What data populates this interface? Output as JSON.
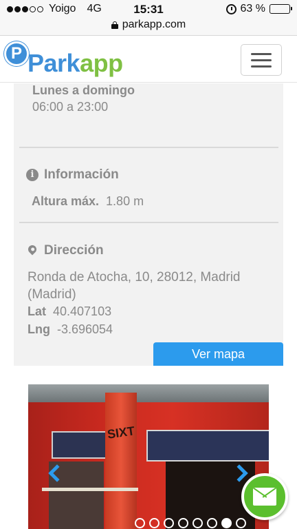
{
  "status_bar": {
    "carrier": "Yoigo",
    "network": "4G",
    "time": "15:31",
    "battery_label": "63 %",
    "battery_level": 0.63
  },
  "browser": {
    "url": "parkapp.com"
  },
  "header": {
    "logo_mark": "P",
    "logo_part1": "Park",
    "logo_part2": "app",
    "colors": {
      "brand_blue": "#3f8fd8",
      "brand_green": "#7fc043"
    }
  },
  "hours": {
    "days": "Lunes a domingo",
    "time": "06:00 a 23:00"
  },
  "info_section": {
    "title": "Información",
    "height_label": "Altura máx.",
    "height_value": "1.80 m"
  },
  "address_section": {
    "title": "Dirección",
    "address": "Ronda de Atocha, 10, 28012, Madrid (Madrid)",
    "lat_label": "Lat",
    "lat_value": "40.407103",
    "lng_label": "Lng",
    "lng_value": "-3.696054",
    "map_button": "Ver mapa"
  },
  "gallery": {
    "photo_sign": "SIXT",
    "pages": 8,
    "active_page": 7,
    "accent": "#2c9bed"
  },
  "contact": {
    "icon": "envelope-icon",
    "color": "#5bbf2e"
  }
}
